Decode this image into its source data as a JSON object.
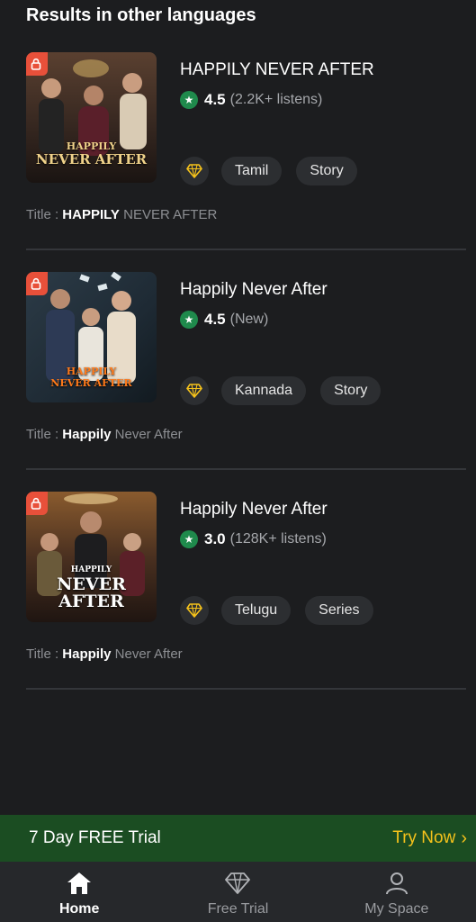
{
  "header": {
    "title": "Results in other languages"
  },
  "results": [
    {
      "cover_text": [
        "HAPPILY",
        "NEVER AFTER"
      ],
      "name": "HAPPILY NEVER AFTER",
      "rating": "4.5",
      "meta": "(2.2K+ listens)",
      "language": "Tamil",
      "format": "Story",
      "title_prefix": "Title : ",
      "title_match": "HAPPILY",
      "title_rest": " NEVER AFTER"
    },
    {
      "cover_text": [
        "HAPPILY",
        "NEVER AFTER"
      ],
      "name": "Happily Never After",
      "rating": "4.5",
      "meta": "(New)",
      "language": "Kannada",
      "format": "Story",
      "title_prefix": "Title : ",
      "title_match": "Happily",
      "title_rest": " Never After"
    },
    {
      "cover_text": [
        "HAPPILY",
        "NEVER AFTER"
      ],
      "name": "Happily Never After",
      "rating": "3.0",
      "meta": "(128K+ listens)",
      "language": "Telugu",
      "format": "Series",
      "title_prefix": "Title : ",
      "title_match": "Happily",
      "title_rest": " Never After"
    }
  ],
  "trial_banner": {
    "text": "7 Day FREE Trial",
    "cta": "Try Now",
    "cta_icon": "chevron-right-icon"
  },
  "bottom_nav": [
    {
      "label": "Home",
      "icon": "home-icon",
      "active": true
    },
    {
      "label": "Free Trial",
      "icon": "diamond-icon",
      "active": false
    },
    {
      "label": "My Space",
      "icon": "user-icon",
      "active": false
    }
  ],
  "colors": {
    "background": "#1c1d1f",
    "rating_green": "#1f8a4c",
    "lock_red": "#e8503a",
    "gem_gold": "#f5c21b",
    "banner_green": "#1b4d22",
    "cta_yellow": "#f5c21b"
  }
}
